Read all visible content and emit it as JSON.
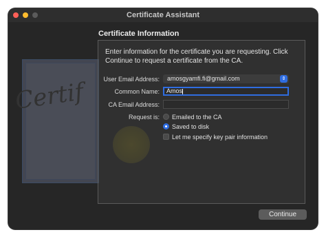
{
  "window": {
    "title": "Certificate Assistant"
  },
  "section": {
    "heading": "Certificate Information",
    "intro_line1": "Enter information for the certificate you are requesting. Click",
    "intro_line2": "Continue to request a certificate from the CA."
  },
  "form": {
    "email_label": "User Email Address:",
    "email_value": "amosgyamfi.fi@gmail.com",
    "common_name_label": "Common Name:",
    "common_name_value": "Amos",
    "ca_email_label": "CA Email Address:",
    "ca_email_value": "",
    "request_label": "Request is:",
    "option_emailed": "Emailed to the CA",
    "option_saved": "Saved to disk",
    "selected_option": "Saved to disk",
    "keypair_label": "Let me specify key pair information",
    "keypair_checked": false
  },
  "artwork": {
    "word": "Certif"
  },
  "footer": {
    "continue_label": "Continue"
  },
  "colors": {
    "accent": "#2f6de1",
    "window_bg": "#262626",
    "close": "#fe5f57",
    "minimize": "#febc2e"
  },
  "icons": [
    "close-button-icon",
    "minimize-button-icon",
    "zoom-button-icon",
    "chevron-updown-icon",
    "certificate-seal-icon"
  ]
}
